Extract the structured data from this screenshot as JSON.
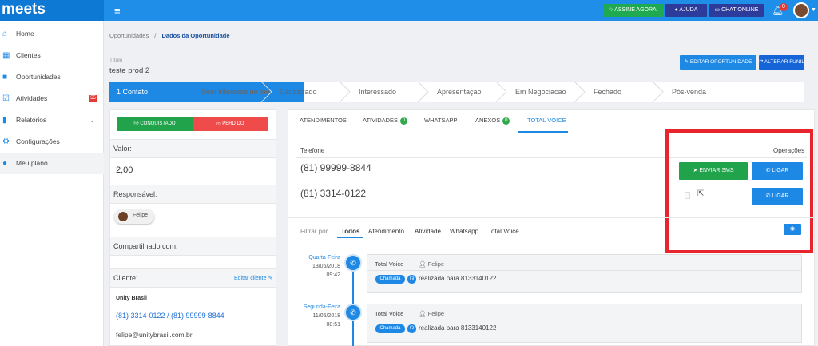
{
  "app": {
    "logo": "meets",
    "menu_icon": "≡"
  },
  "topbar": {
    "sign_label": "ASSINE AGORA!",
    "help_label": "AJUDA",
    "chat_label": "CHAT ONLINE",
    "notif_count": "0",
    "colors": {
      "sign": "#1faa52",
      "help": "#2d3c9a",
      "chat": "#2d3c9a"
    }
  },
  "sidebar": {
    "items": [
      {
        "label": "Home",
        "icon": "home-icon"
      },
      {
        "label": "Clientes",
        "icon": "building-icon"
      },
      {
        "label": "Oportunidades",
        "icon": "briefcase-icon"
      },
      {
        "label": "Atividades",
        "icon": "check-icon",
        "badge": "55"
      },
      {
        "label": "Relatórios",
        "icon": "bar-chart-icon",
        "arrow": "⌄"
      },
      {
        "label": "Configurações",
        "icon": "gear-icon"
      },
      {
        "label": "Meu plano",
        "icon": "user-icon"
      }
    ]
  },
  "breadcrumb": {
    "parent": "Oportunidades",
    "separator": "/",
    "current": "Dados da Oportunidade"
  },
  "header": {
    "title_label": "Título",
    "title": "teste prod 2",
    "edit_label": "EDITAR OPORTUNIDADE",
    "funnel_label": "ALTERAR FUNIL"
  },
  "pipeline": {
    "stages": [
      "1 Contato",
      "Sem Interesse no mo",
      "Cadastrado",
      "Interessado",
      "Apresentaçao",
      "Em Negociacao",
      "Fechado",
      "Pós-venda"
    ]
  },
  "left_panel": {
    "won_label": "CONQUISTADO",
    "lost_label": "PERDIDO",
    "value_label": "Valor:",
    "value": "2,00",
    "responsible_label": "Responsável:",
    "responsible_name": "Felipe",
    "shared_label": "Compartilhado com:",
    "client_label": "Cliente:",
    "edit_client_label": "Editar cliente ✎",
    "client_name": "Unity Brasil",
    "client_phones": "(81) 3314-0122 / (81) 99999-8844",
    "client_email": "felipe@unitybrasil.com.br"
  },
  "tabs": [
    {
      "label": "ATENDIMENTOS"
    },
    {
      "label": "ATIVIDADES",
      "badge": "0"
    },
    {
      "label": "WHATSAPP"
    },
    {
      "label": "ANEXOS",
      "badge": "0"
    },
    {
      "label": "TOTAL VOICE",
      "active": true
    }
  ],
  "voice": {
    "phone_header": "Telefone",
    "operations_header": "Operações",
    "phones": [
      "(81) 99999-8844",
      "(81) 3314-0122"
    ],
    "sms_label": "ENVIAR SMS",
    "call_label": "LIGAR"
  },
  "filter": {
    "label": "Filtrar por",
    "options": [
      "Todos",
      "Atendimento",
      "Atividade",
      "Whatsapp",
      "Total Voice"
    ],
    "active": "Todos"
  },
  "timeline": [
    {
      "weekday": "Quarta-Feira",
      "date": "13/06/2018",
      "time": "09:42",
      "title": "Total Voice",
      "user": "Felipe",
      "tag": "Chamada",
      "text": "realizada para 8133140122"
    },
    {
      "weekday": "Segunda-Feira",
      "date": "11/06/2018",
      "time": "08:51",
      "title": "Total Voice",
      "user": "Felipe",
      "tag": "Chamada",
      "text": "realizada para 8133140122"
    }
  ]
}
